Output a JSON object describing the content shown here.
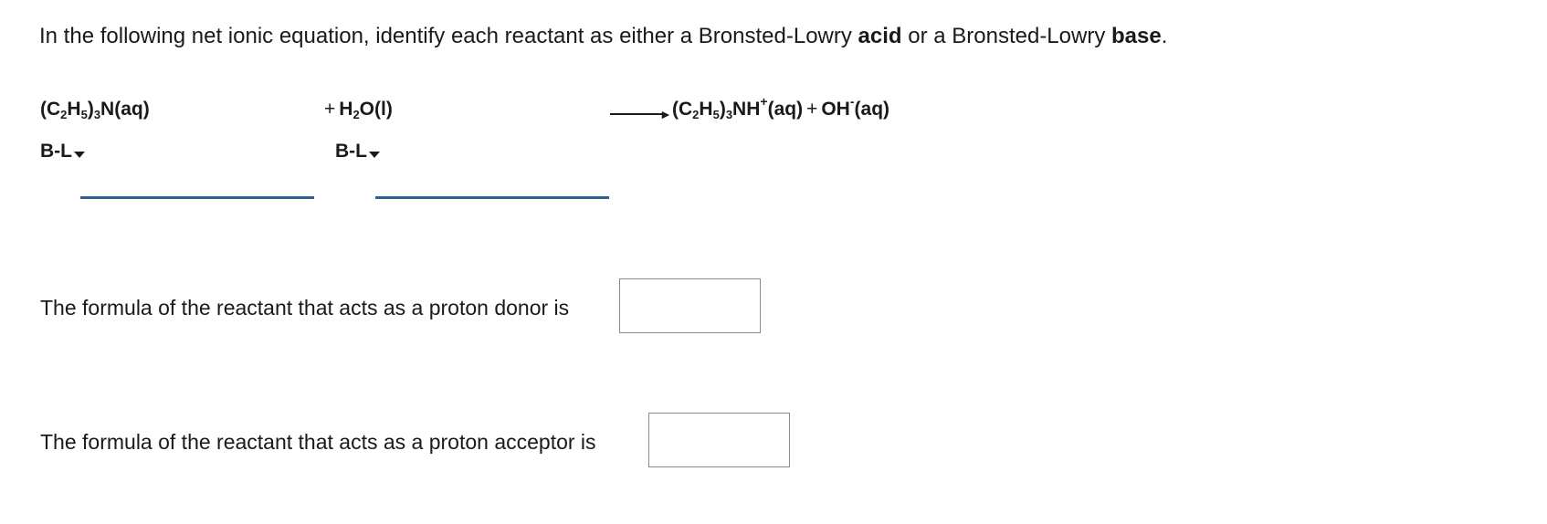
{
  "instruction": {
    "part1": "In the following net ionic equation, identify each reactant as either a Bronsted-Lowry ",
    "acid": "acid",
    "part2": " or a Bronsted-Lowry ",
    "base": "base",
    "part3": "."
  },
  "equation": {
    "reactant1": {
      "open": "(C",
      "s1": "2",
      "h": "H",
      "s2": "5",
      "close": ")",
      "s3": "3",
      "rest": "N(aq)"
    },
    "reactant2": {
      "plus": "+",
      "h": "H",
      "s1": "2",
      "rest": "O(l)"
    },
    "product1": {
      "open": "(C",
      "s1": "2",
      "h": "H",
      "s2": "5",
      "close": ")",
      "s3": "3",
      "rest": "NH",
      "charge": "+",
      "state": "(aq)"
    },
    "plus2": "+",
    "product2": {
      "main": "OH",
      "charge": "-",
      "state": "(aq)"
    }
  },
  "dropdowns": {
    "reactant1": "B-L",
    "reactant2": "B-L"
  },
  "questions": {
    "donor": "The formula of the reactant that acts as a proton donor is",
    "acceptor": "The formula of the reactant that acts as a proton acceptor is"
  },
  "answers": {
    "donor": "",
    "acceptor": ""
  },
  "colors": {
    "answer_line": "#2e5e98",
    "box_border": "#8a8a8a"
  }
}
